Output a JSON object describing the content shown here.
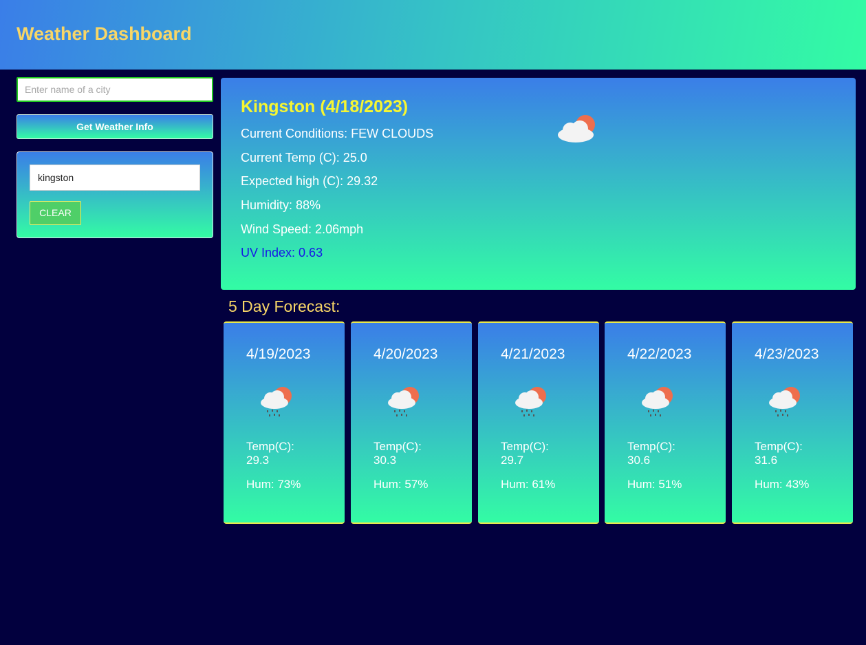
{
  "header": {
    "title": "Weather Dashboard"
  },
  "search": {
    "placeholder": "Enter name of a city",
    "value": "",
    "button_label": "Get Weather Info"
  },
  "history": {
    "items": [
      "kingston"
    ],
    "clear_label": "CLEAR"
  },
  "current": {
    "city_date": "Kingston (4/18/2023)",
    "conditions": "Current Conditions: FEW CLOUDS",
    "temp": "Current Temp (C): 25.0",
    "high": "Expected high (C): 29.32",
    "humidity": "Humidity: 88%",
    "wind": "Wind Speed: 2.06mph",
    "uv": "UV Index: 0.63",
    "icon": "few-clouds-icon"
  },
  "forecast": {
    "title": "5 Day Forecast:",
    "days": [
      {
        "date": "4/19/2023",
        "temp_label": "Temp(C):",
        "temp": "29.3",
        "hum": "Hum: 73%",
        "icon": "rain-cloud-sun-icon"
      },
      {
        "date": "4/20/2023",
        "temp_label": "Temp(C):",
        "temp": "30.3",
        "hum": "Hum: 57%",
        "icon": "rain-cloud-sun-icon"
      },
      {
        "date": "4/21/2023",
        "temp_label": "Temp(C):",
        "temp": "29.7",
        "hum": "Hum: 61%",
        "icon": "rain-cloud-sun-icon"
      },
      {
        "date": "4/22/2023",
        "temp_label": "Temp(C):",
        "temp": "30.6",
        "hum": "Hum: 51%",
        "icon": "rain-cloud-sun-icon"
      },
      {
        "date": "4/23/2023",
        "temp_label": "Temp(C):",
        "temp": "31.6",
        "hum": "Hum: 43%",
        "icon": "rain-cloud-sun-icon"
      }
    ]
  },
  "colors": {
    "page_bg": "#02003e",
    "title_yellow": "#f8d667",
    "city_yellow": "#f6f631",
    "uv_blue": "#1616e6",
    "gradient_top": "#3a7ee8",
    "gradient_bottom": "#33fca4"
  }
}
